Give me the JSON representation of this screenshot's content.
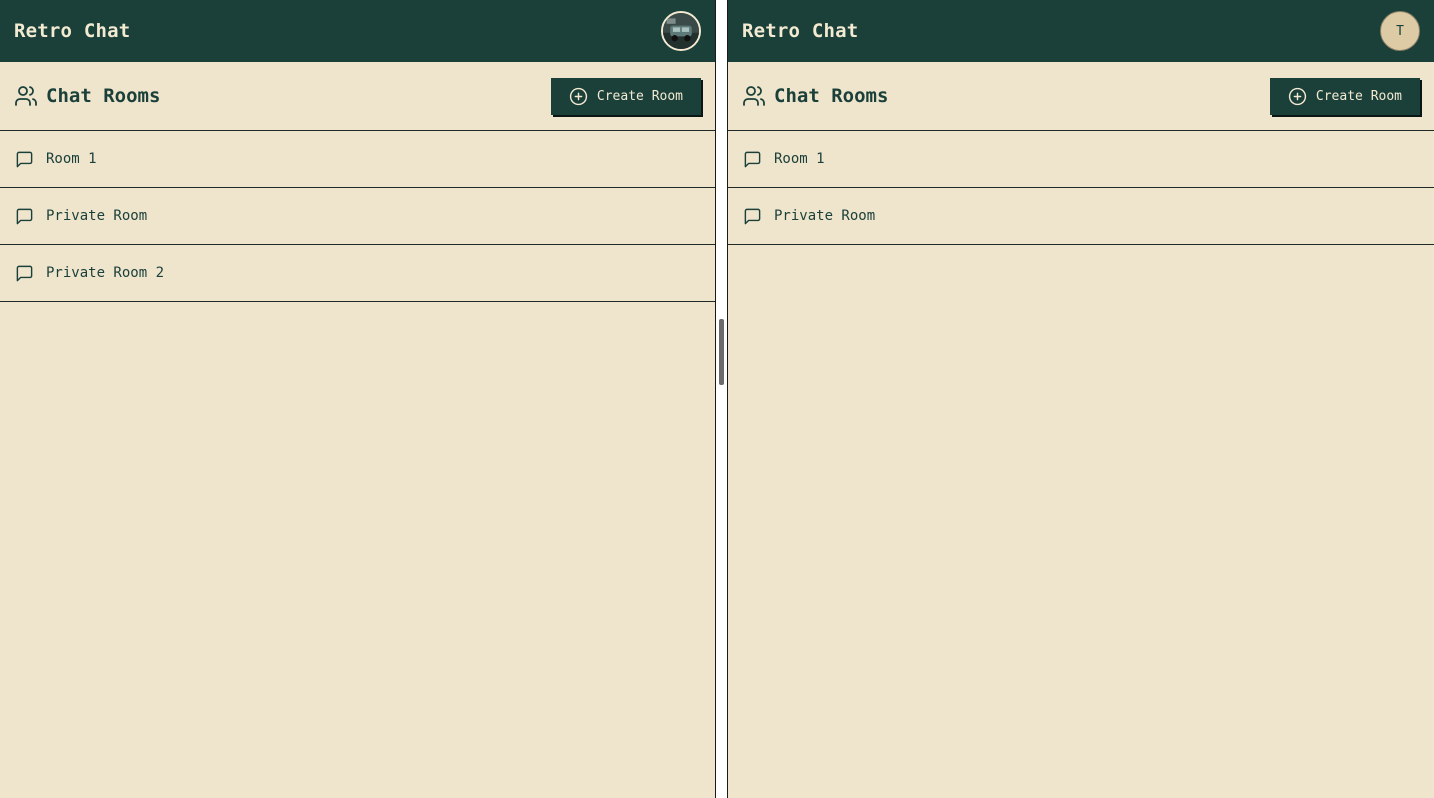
{
  "left_window": {
    "header": {
      "title": "Retro Chat",
      "avatar": {
        "type": "photo"
      }
    },
    "rooms_bar": {
      "heading": "Chat Rooms",
      "create_label": "Create Room"
    },
    "rooms": [
      {
        "name": "Room 1"
      },
      {
        "name": "Private Room"
      },
      {
        "name": "Private Room 2"
      }
    ]
  },
  "right_window": {
    "header": {
      "title": "Retro Chat",
      "avatar": {
        "type": "initial",
        "initial": "T"
      }
    },
    "rooms_bar": {
      "heading": "Chat Rooms",
      "create_label": "Create Room"
    },
    "rooms": [
      {
        "name": "Room 1"
      },
      {
        "name": "Private Room"
      }
    ]
  },
  "icons": {
    "rooms_heading": "users-icon",
    "create": "plus-circle-icon",
    "room": "message-square-icon",
    "divider": "drag-handle"
  },
  "colors": {
    "header_bg": "#1b403a",
    "page_bg": "#efe5cd",
    "header_text": "#f3ead2",
    "accent": "#1b403a"
  }
}
